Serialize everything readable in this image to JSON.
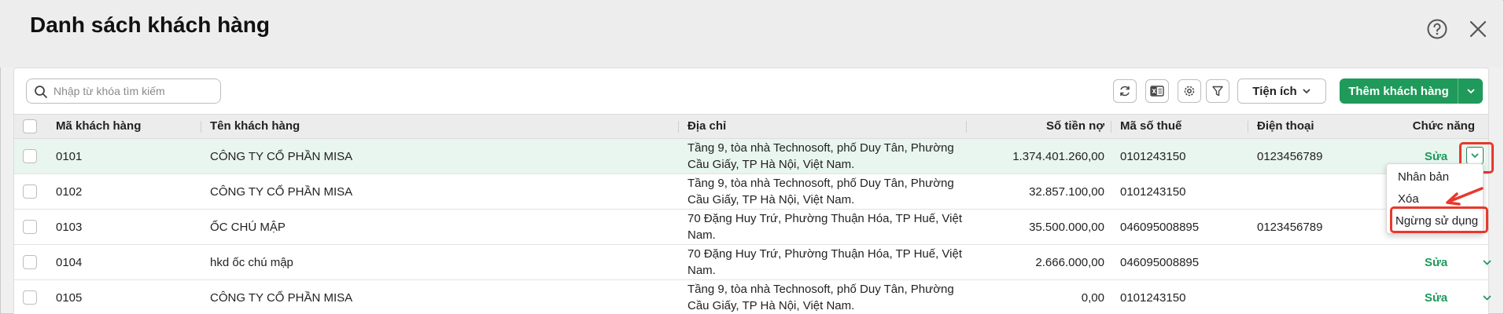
{
  "page": {
    "title": "Danh sách khách hàng"
  },
  "toolbar": {
    "search_placeholder": "Nhập từ khóa tìm kiếm",
    "utilities_label": "Tiện ích",
    "add_customer_label": "Thêm khách hàng",
    "icons": [
      "refresh-icon",
      "excel-icon",
      "settings-icon",
      "filter-icon"
    ]
  },
  "table": {
    "columns": {
      "code": "Mã khách hàng",
      "name": "Tên khách hàng",
      "address": "Địa chỉ",
      "debt": "Số tiền nợ",
      "tax": "Mã số thuế",
      "phone": "Điện thoại",
      "action": "Chức năng"
    },
    "rows": [
      {
        "code": "0101",
        "name": "CÔNG TY CỔ PHẦN MISA",
        "address": "Tầng 9, tòa nhà Technosoft, phố Duy Tân, Phường Cầu Giấy, TP Hà Nội, Việt Nam.",
        "debt": "1.374.401.260,00",
        "tax": "0101243150",
        "phone": "0123456789",
        "edit": "Sửa"
      },
      {
        "code": "0102",
        "name": "CÔNG TY CỔ PHẦN MISA",
        "address": "Tầng 9, tòa nhà Technosoft, phố Duy Tân, Phường Cầu Giấy, TP Hà Nội, Việt Nam.",
        "debt": "32.857.100,00",
        "tax": "0101243150",
        "phone": "",
        "edit": ""
      },
      {
        "code": "0103",
        "name": "ỐC CHÚ MẬP",
        "address": "70 Đặng Huy Trứ, Phường Thuận Hóa, TP Huế, Việt Nam.",
        "debt": "35.500.000,00",
        "tax": "046095008895",
        "phone": "0123456789",
        "edit": ""
      },
      {
        "code": "0104",
        "name": "hkd ốc chú mập",
        "address": "70 Đặng Huy Trứ, Phường Thuận Hóa, TP Huế, Việt Nam.",
        "debt": "2.666.000,00",
        "tax": "046095008895",
        "phone": "",
        "edit": "Sửa"
      },
      {
        "code": "0105",
        "name": "CÔNG TY CỔ PHẦN MISA",
        "address": "Tầng 9, tòa nhà Technosoft, phố Duy Tân, Phường Cầu Giấy, TP Hà Nội, Việt Nam.",
        "debt": "0,00",
        "tax": "0101243150",
        "phone": "",
        "edit": "Sửa"
      }
    ]
  },
  "row_menu": {
    "items": [
      "Nhân bản",
      "Xóa",
      "Ngừng sử dụng"
    ]
  },
  "colors": {
    "accent_green": "#1f9a5a",
    "highlight_row": "#e9f5ef",
    "annotation_red": "#e8382c"
  }
}
